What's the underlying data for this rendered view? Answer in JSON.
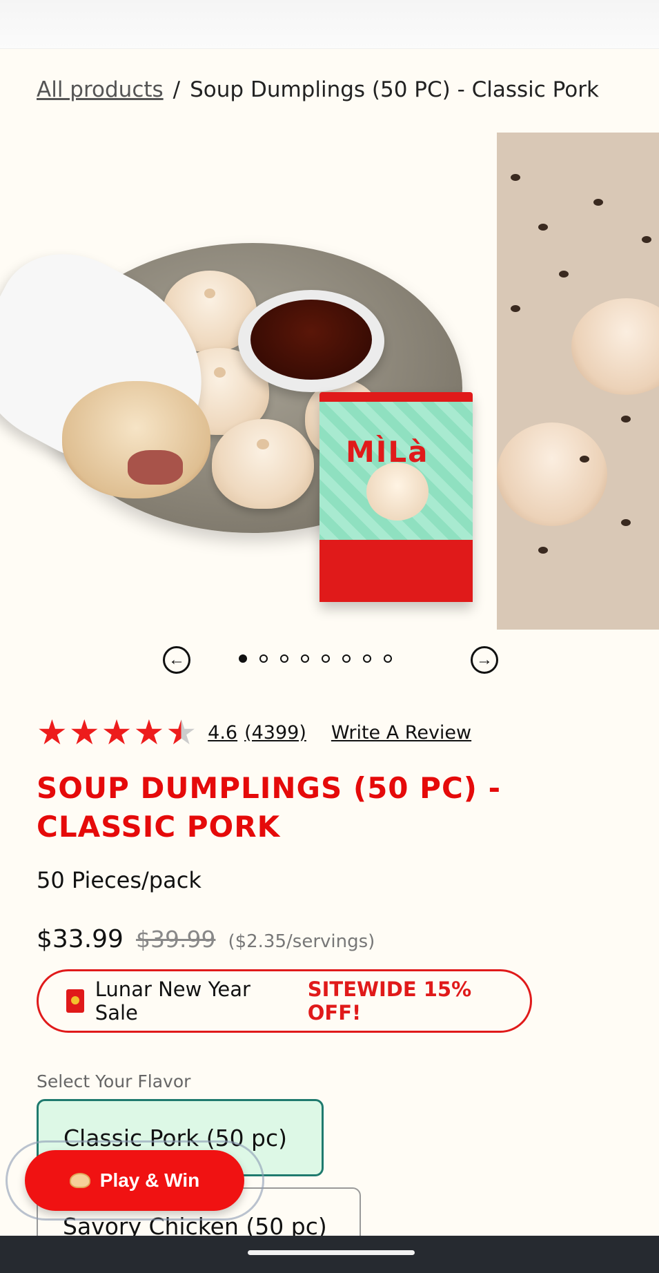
{
  "breadcrumb": {
    "parent": "All products",
    "separator": "/",
    "current": "Soup Dumplings (50 PC) - Classic Pork"
  },
  "gallery": {
    "slide_count": 8,
    "active_index": 0,
    "slide1": {
      "bag_logo": "MÌLà"
    },
    "prev_icon": "arrow-left-icon",
    "next_icon": "arrow-right-icon"
  },
  "rating": {
    "value": "4.6",
    "stars_out_of_5": 4.6,
    "count": "(4399)",
    "write_review": "Write A Review"
  },
  "product": {
    "title": "SOUP DUMPLINGS (50 PC) - CLASSIC PORK",
    "pack": "50 Pieces/pack",
    "price_now": "$33.99",
    "price_was": "$39.99",
    "price_per_serving": "($2.35/servings)"
  },
  "promo": {
    "icon": "red-envelope-icon",
    "text": "Lunar New Year Sale",
    "highlight": "SITEWIDE 15% OFF!"
  },
  "flavor": {
    "label": "Select Your Flavor",
    "options": [
      {
        "label": "Classic Pork (50 pc)",
        "selected": true
      },
      {
        "label": "Savory Chicken (50 pc)",
        "selected": false
      }
    ]
  },
  "play_win": {
    "label": "Play & Win",
    "icon": "dumpling-icon"
  },
  "colors": {
    "brand_red": "#e50a0a",
    "background": "#fffcf5",
    "selected_border": "#1f7a6e",
    "selected_bg": "#ddf8e6"
  }
}
